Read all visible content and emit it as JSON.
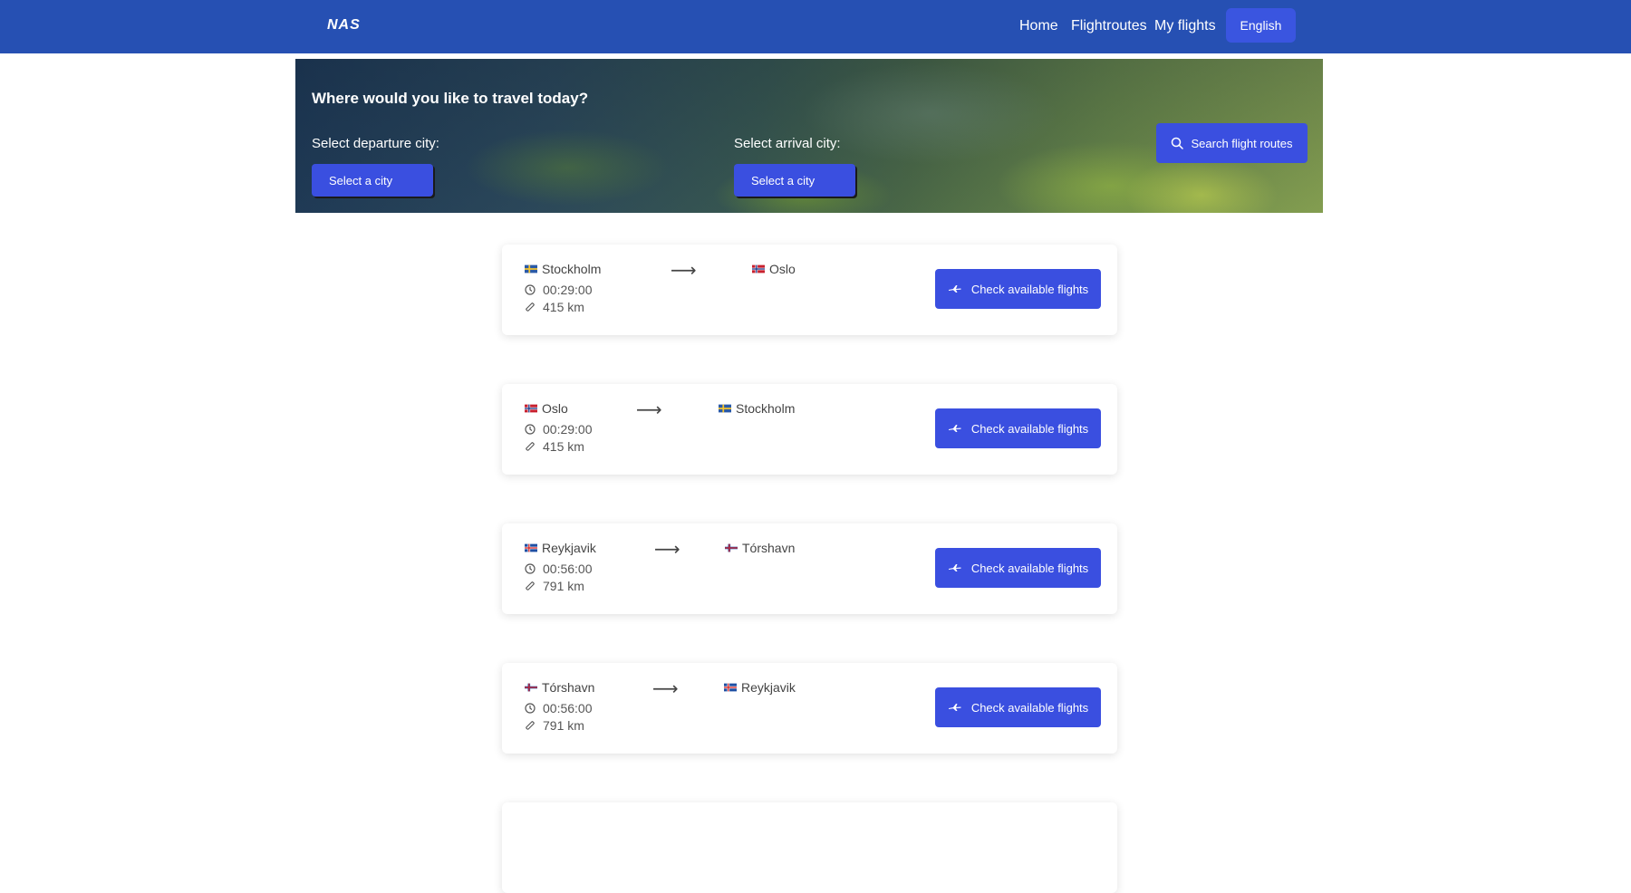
{
  "navbar": {
    "brand": "NAS",
    "links": [
      "Home",
      "Flightroutes",
      "My flights"
    ],
    "language": "English"
  },
  "hero": {
    "title": "Where would you like to travel today?",
    "departure_label": "Select departure city:",
    "arrival_label": "Select arrival city:",
    "departure_value": "Select a city",
    "arrival_value": "Select a city",
    "search_label": "Search flight routes"
  },
  "routes": [
    {
      "from": "Stockholm",
      "from_flag": "sweden",
      "to": "Oslo",
      "to_flag": "norway",
      "duration": "00:29:00",
      "distance": "415 km",
      "button": "Check available flights"
    },
    {
      "from": "Oslo",
      "from_flag": "norway",
      "to": "Stockholm",
      "to_flag": "sweden",
      "duration": "00:29:00",
      "distance": "415 km",
      "button": "Check available flights"
    },
    {
      "from": "Reykjavik",
      "from_flag": "iceland",
      "to": "Tórshavn",
      "to_flag": "faroe",
      "duration": "00:56:00",
      "distance": "791 km",
      "button": "Check available flights"
    },
    {
      "from": "Tórshavn",
      "from_flag": "faroe",
      "to": "Reykjavik",
      "to_flag": "iceland",
      "duration": "00:56:00",
      "distance": "791 km",
      "button": "Check available flights"
    }
  ],
  "colors": {
    "navbar": "#2650b3",
    "accent": "#3a4fe0"
  }
}
